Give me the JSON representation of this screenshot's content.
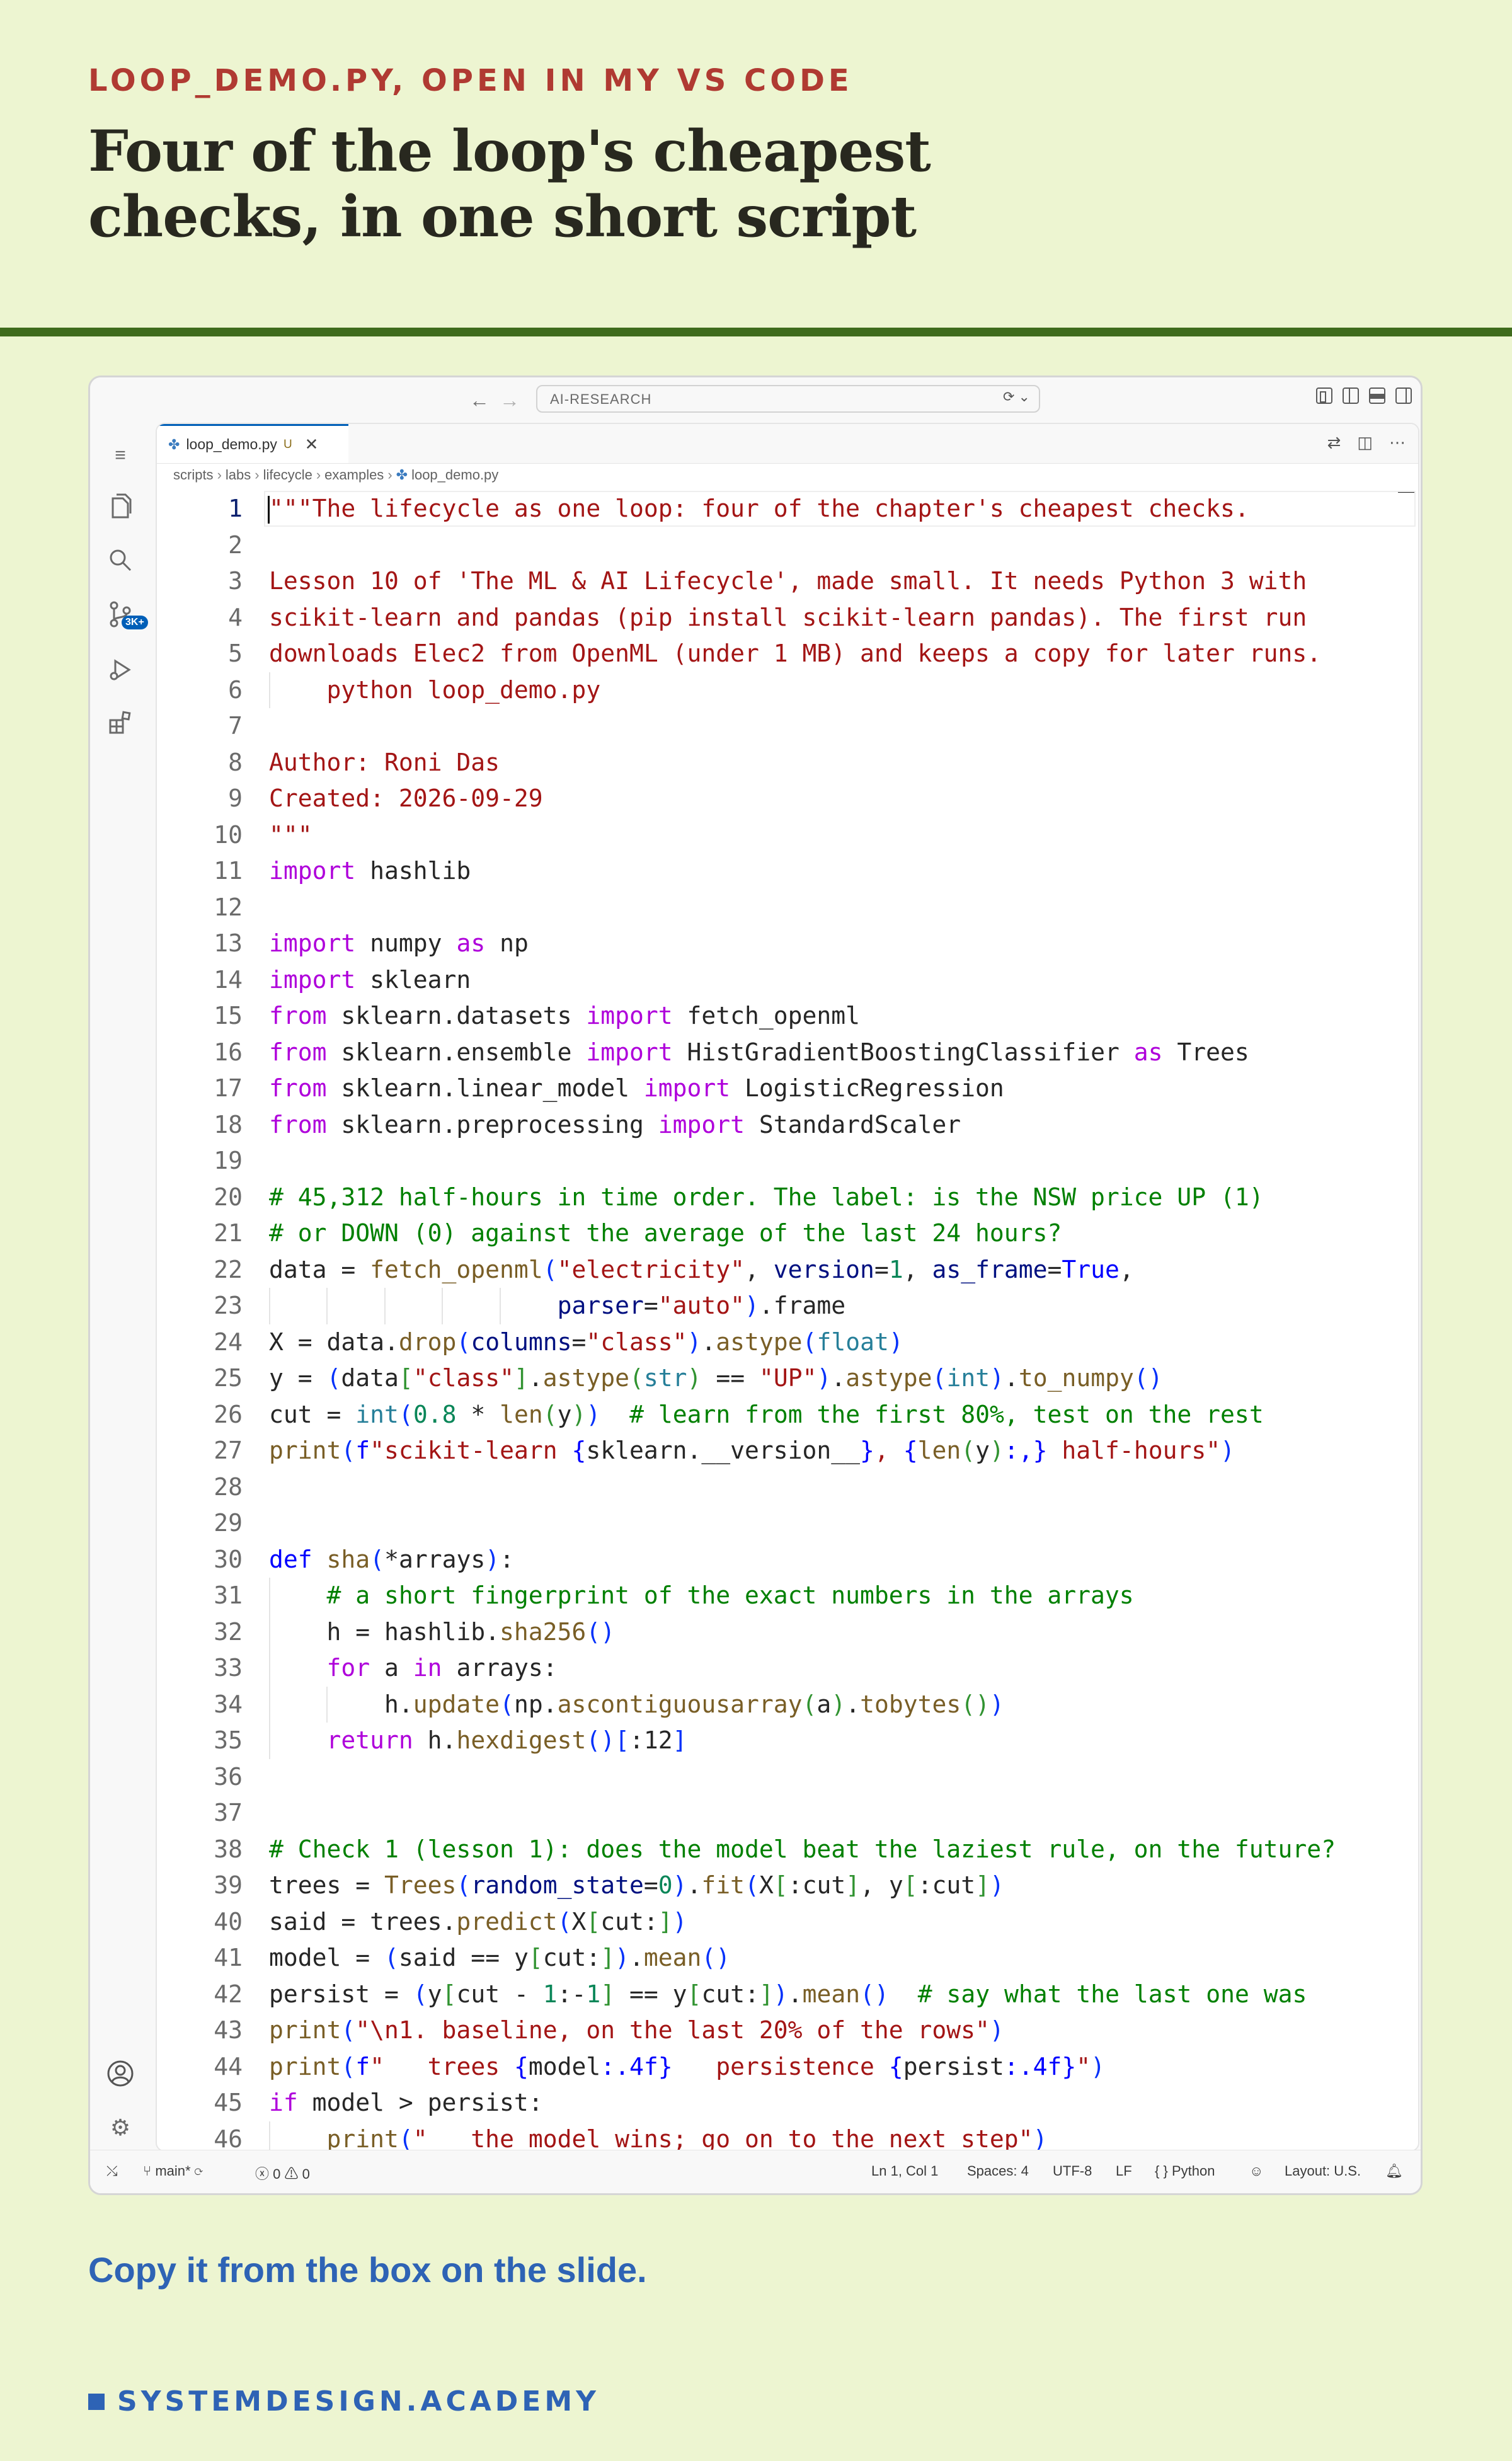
{
  "slide": {
    "kicker": "LOOP_DEMO.PY, OPEN IN MY VS CODE",
    "headline_lines": [
      "Four of the loop's cheapest",
      "checks, in one short script"
    ],
    "cta": "Copy it from the box on the slide.",
    "brand": "SYSTEMDESIGN.ACADEMY",
    "colors": {
      "background": "#edf5d1",
      "kicker": "#b03a32",
      "rule": "#3f6b1c",
      "brand": "#2e63b5"
    }
  },
  "vscode": {
    "search_text": "AI-RESEARCH",
    "tab": {
      "filename": "loop_demo.py",
      "status": "U"
    },
    "breadcrumb": [
      "scripts",
      "labs",
      "lifecycle",
      "examples",
      "loop_demo.py"
    ],
    "scm_badge": "3K+",
    "status": {
      "branch": "main*",
      "errors": "0",
      "warnings": "0",
      "position": "Ln 1, Col 1",
      "indent": "Spaces: 4",
      "encoding": "UTF-8",
      "eol": "LF",
      "language_mode": "Python",
      "layout": "Layout: U.S."
    },
    "code_lines": [
      [
        [
          "s",
          "\"\"\"The lifecycle as one loop: four of the chapter's cheapest checks."
        ]
      ],
      [],
      [
        [
          "s",
          "Lesson 10 of 'The ML & AI Lifecycle', made small. It needs Python 3 with"
        ]
      ],
      [
        [
          "s",
          "scikit-learn and pandas (pip install scikit-learn pandas). The first run"
        ]
      ],
      [
        [
          "s",
          "downloads Elec2 from OpenML (under 1 MB) and keeps a copy for later runs."
        ]
      ],
      [
        [
          "s",
          "    python loop_demo.py"
        ]
      ],
      [],
      [
        [
          "s",
          "Author: Roni Das"
        ]
      ],
      [
        [
          "s",
          "Created: 2026-09-29"
        ]
      ],
      [
        [
          "s",
          "\"\"\""
        ]
      ],
      [
        [
          "k",
          "import"
        ],
        [
          "t",
          " hashlib"
        ]
      ],
      [],
      [
        [
          "k",
          "import"
        ],
        [
          "t",
          " numpy "
        ],
        [
          "k",
          "as"
        ],
        [
          "t",
          " np"
        ]
      ],
      [
        [
          "k",
          "import"
        ],
        [
          "t",
          " sklearn"
        ]
      ],
      [
        [
          "k",
          "from"
        ],
        [
          "t",
          " sklearn.datasets "
        ],
        [
          "k",
          "import"
        ],
        [
          "t",
          " fetch_openml"
        ]
      ],
      [
        [
          "k",
          "from"
        ],
        [
          "t",
          " sklearn.ensemble "
        ],
        [
          "k",
          "import"
        ],
        [
          "t",
          " HistGradientBoostingClassifier "
        ],
        [
          "k",
          "as"
        ],
        [
          "t",
          " Trees"
        ]
      ],
      [
        [
          "k",
          "from"
        ],
        [
          "t",
          " sklearn.linear_model "
        ],
        [
          "k",
          "import"
        ],
        [
          "t",
          " LogisticRegression"
        ]
      ],
      [
        [
          "k",
          "from"
        ],
        [
          "t",
          " sklearn.preprocessing "
        ],
        [
          "k",
          "import"
        ],
        [
          "t",
          " StandardScaler"
        ]
      ],
      [],
      [
        [
          "c",
          "# 45,312 half-hours in time order. The label: is the NSW price UP (1)"
        ]
      ],
      [
        [
          "c",
          "# or DOWN (0) against the average of the last 24 hours?"
        ]
      ],
      [
        [
          "t",
          "data = "
        ],
        [
          "f",
          "fetch_openml"
        ],
        [
          "p1",
          "("
        ],
        [
          "s",
          "\"electricity\""
        ],
        [
          "t",
          ", "
        ],
        [
          "v",
          "version"
        ],
        [
          "t",
          "="
        ],
        [
          "n",
          "1"
        ],
        [
          "t",
          ", "
        ],
        [
          "v",
          "as_frame"
        ],
        [
          "t",
          "="
        ],
        [
          "d",
          "True"
        ],
        [
          "t",
          ","
        ]
      ],
      [
        [
          "t",
          "                    "
        ],
        [
          "v",
          "parser"
        ],
        [
          "t",
          "="
        ],
        [
          "s",
          "\"auto\""
        ],
        [
          "p1",
          ")"
        ],
        [
          "t",
          ".frame"
        ]
      ],
      [
        [
          "t",
          "X = data."
        ],
        [
          "f",
          "drop"
        ],
        [
          "p1",
          "("
        ],
        [
          "v",
          "columns"
        ],
        [
          "t",
          "="
        ],
        [
          "s",
          "\"class\""
        ],
        [
          "p1",
          ")"
        ],
        [
          "t",
          "."
        ],
        [
          "f",
          "astype"
        ],
        [
          "p1",
          "("
        ],
        [
          "b",
          "float"
        ],
        [
          "p1",
          ")"
        ]
      ],
      [
        [
          "t",
          "y = "
        ],
        [
          "p1",
          "("
        ],
        [
          "t",
          "data"
        ],
        [
          "p2",
          "["
        ],
        [
          "s",
          "\"class\""
        ],
        [
          "p2",
          "]"
        ],
        [
          "t",
          "."
        ],
        [
          "f",
          "astype"
        ],
        [
          "p2",
          "("
        ],
        [
          "b",
          "str"
        ],
        [
          "p2",
          ")"
        ],
        [
          "t",
          " == "
        ],
        [
          "s",
          "\"UP\""
        ],
        [
          "p1",
          ")"
        ],
        [
          "t",
          "."
        ],
        [
          "f",
          "astype"
        ],
        [
          "p1",
          "("
        ],
        [
          "b",
          "int"
        ],
        [
          "p1",
          ")"
        ],
        [
          "t",
          "."
        ],
        [
          "f",
          "to_numpy"
        ],
        [
          "p1",
          "()"
        ]
      ],
      [
        [
          "t",
          "cut = "
        ],
        [
          "b",
          "int"
        ],
        [
          "p1",
          "("
        ],
        [
          "n",
          "0.8"
        ],
        [
          "t",
          " * "
        ],
        [
          "f",
          "len"
        ],
        [
          "p2",
          "("
        ],
        [
          "t",
          "y"
        ],
        [
          "p2",
          ")"
        ],
        [
          "p1",
          ")"
        ],
        [
          "t",
          "  "
        ],
        [
          "c",
          "# learn from the first 80%, test on the rest"
        ]
      ],
      [
        [
          "f",
          "print"
        ],
        [
          "p1",
          "("
        ],
        [
          "d",
          "f"
        ],
        [
          "s",
          "\"scikit-learn "
        ],
        [
          "d",
          "{"
        ],
        [
          "t",
          "sklearn.__version__"
        ],
        [
          "d",
          "}"
        ],
        [
          "s",
          ", "
        ],
        [
          "d",
          "{"
        ],
        [
          "f",
          "len"
        ],
        [
          "p2",
          "("
        ],
        [
          "t",
          "y"
        ],
        [
          "p2",
          ")"
        ],
        [
          "d",
          ":,}"
        ],
        [
          "s",
          " half-hours\""
        ],
        [
          "p1",
          ")"
        ]
      ],
      [],
      [],
      [
        [
          "d",
          "def"
        ],
        [
          "t",
          " "
        ],
        [
          "f",
          "sha"
        ],
        [
          "p1",
          "("
        ],
        [
          "t",
          "*arrays"
        ],
        [
          "p1",
          ")"
        ],
        [
          "t",
          ":"
        ]
      ],
      [
        [
          "t",
          "    "
        ],
        [
          "c",
          "# a short fingerprint of the exact numbers in the arrays"
        ]
      ],
      [
        [
          "t",
          "    h = hashlib."
        ],
        [
          "f",
          "sha256"
        ],
        [
          "p1",
          "()"
        ]
      ],
      [
        [
          "t",
          "    "
        ],
        [
          "k",
          "for"
        ],
        [
          "t",
          " a "
        ],
        [
          "k",
          "in"
        ],
        [
          "t",
          " arrays:"
        ]
      ],
      [
        [
          "t",
          "        h."
        ],
        [
          "f",
          "update"
        ],
        [
          "p1",
          "("
        ],
        [
          "t",
          "np."
        ],
        [
          "f",
          "ascontiguousarray"
        ],
        [
          "p2",
          "("
        ],
        [
          "t",
          "a"
        ],
        [
          "p2",
          ")"
        ],
        [
          "t",
          "."
        ],
        [
          "f",
          "tobytes"
        ],
        [
          "p2",
          "()"
        ],
        [
          "p1",
          ")"
        ]
      ],
      [
        [
          "t",
          "    "
        ],
        [
          "k",
          "return"
        ],
        [
          "t",
          " h."
        ],
        [
          "f",
          "hexdigest"
        ],
        [
          "p1",
          "()"
        ],
        [
          "p1",
          "["
        ],
        [
          "t",
          ":12"
        ],
        [
          "p1",
          "]"
        ]
      ],
      [],
      [],
      [
        [
          "c",
          "# Check 1 (lesson 1): does the model beat the laziest rule, on the future?"
        ]
      ],
      [
        [
          "t",
          "trees = "
        ],
        [
          "f",
          "Trees"
        ],
        [
          "p1",
          "("
        ],
        [
          "v",
          "random_state"
        ],
        [
          "t",
          "="
        ],
        [
          "n",
          "0"
        ],
        [
          "p1",
          ")"
        ],
        [
          "t",
          "."
        ],
        [
          "f",
          "fit"
        ],
        [
          "p1",
          "("
        ],
        [
          "t",
          "X"
        ],
        [
          "p2",
          "["
        ],
        [
          "t",
          ":cut"
        ],
        [
          "p2",
          "]"
        ],
        [
          "t",
          ", y"
        ],
        [
          "p2",
          "["
        ],
        [
          "t",
          ":cut"
        ],
        [
          "p2",
          "]"
        ],
        [
          "p1",
          ")"
        ]
      ],
      [
        [
          "t",
          "said = trees."
        ],
        [
          "f",
          "predict"
        ],
        [
          "p1",
          "("
        ],
        [
          "t",
          "X"
        ],
        [
          "p2",
          "["
        ],
        [
          "t",
          "cut:"
        ],
        [
          "p2",
          "]"
        ],
        [
          "p1",
          ")"
        ]
      ],
      [
        [
          "t",
          "model = "
        ],
        [
          "p1",
          "("
        ],
        [
          "t",
          "said == y"
        ],
        [
          "p2",
          "["
        ],
        [
          "t",
          "cut:"
        ],
        [
          "p2",
          "]"
        ],
        [
          "p1",
          ")"
        ],
        [
          "t",
          "."
        ],
        [
          "f",
          "mean"
        ],
        [
          "p1",
          "()"
        ]
      ],
      [
        [
          "t",
          "persist = "
        ],
        [
          "p1",
          "("
        ],
        [
          "t",
          "y"
        ],
        [
          "p2",
          "["
        ],
        [
          "t",
          "cut - "
        ],
        [
          "n",
          "1"
        ],
        [
          "t",
          ":-"
        ],
        [
          "n",
          "1"
        ],
        [
          "p2",
          "]"
        ],
        [
          "t",
          " == y"
        ],
        [
          "p2",
          "["
        ],
        [
          "t",
          "cut:"
        ],
        [
          "p2",
          "]"
        ],
        [
          "p1",
          ")"
        ],
        [
          "t",
          "."
        ],
        [
          "f",
          "mean"
        ],
        [
          "p1",
          "()"
        ],
        [
          "t",
          "  "
        ],
        [
          "c",
          "# say what the last one was"
        ]
      ],
      [
        [
          "f",
          "print"
        ],
        [
          "p1",
          "("
        ],
        [
          "s",
          "\"\\n1. baseline, on the last 20% of the rows\""
        ],
        [
          "p1",
          ")"
        ]
      ],
      [
        [
          "f",
          "print"
        ],
        [
          "p1",
          "("
        ],
        [
          "d",
          "f"
        ],
        [
          "s",
          "\"   trees "
        ],
        [
          "d",
          "{"
        ],
        [
          "t",
          "model"
        ],
        [
          "d",
          ":.4f}"
        ],
        [
          "s",
          "   persistence "
        ],
        [
          "d",
          "{"
        ],
        [
          "t",
          "persist"
        ],
        [
          "d",
          ":.4f}"
        ],
        [
          "s",
          "\""
        ],
        [
          "p1",
          ")"
        ]
      ],
      [
        [
          "k",
          "if"
        ],
        [
          "t",
          " model > persist:"
        ]
      ],
      [
        [
          "t",
          "    "
        ],
        [
          "f",
          "print"
        ],
        [
          "p1",
          "("
        ],
        [
          "s",
          "\"   the model wins; go on to the next step\""
        ],
        [
          "p1",
          ")"
        ]
      ]
    ]
  }
}
